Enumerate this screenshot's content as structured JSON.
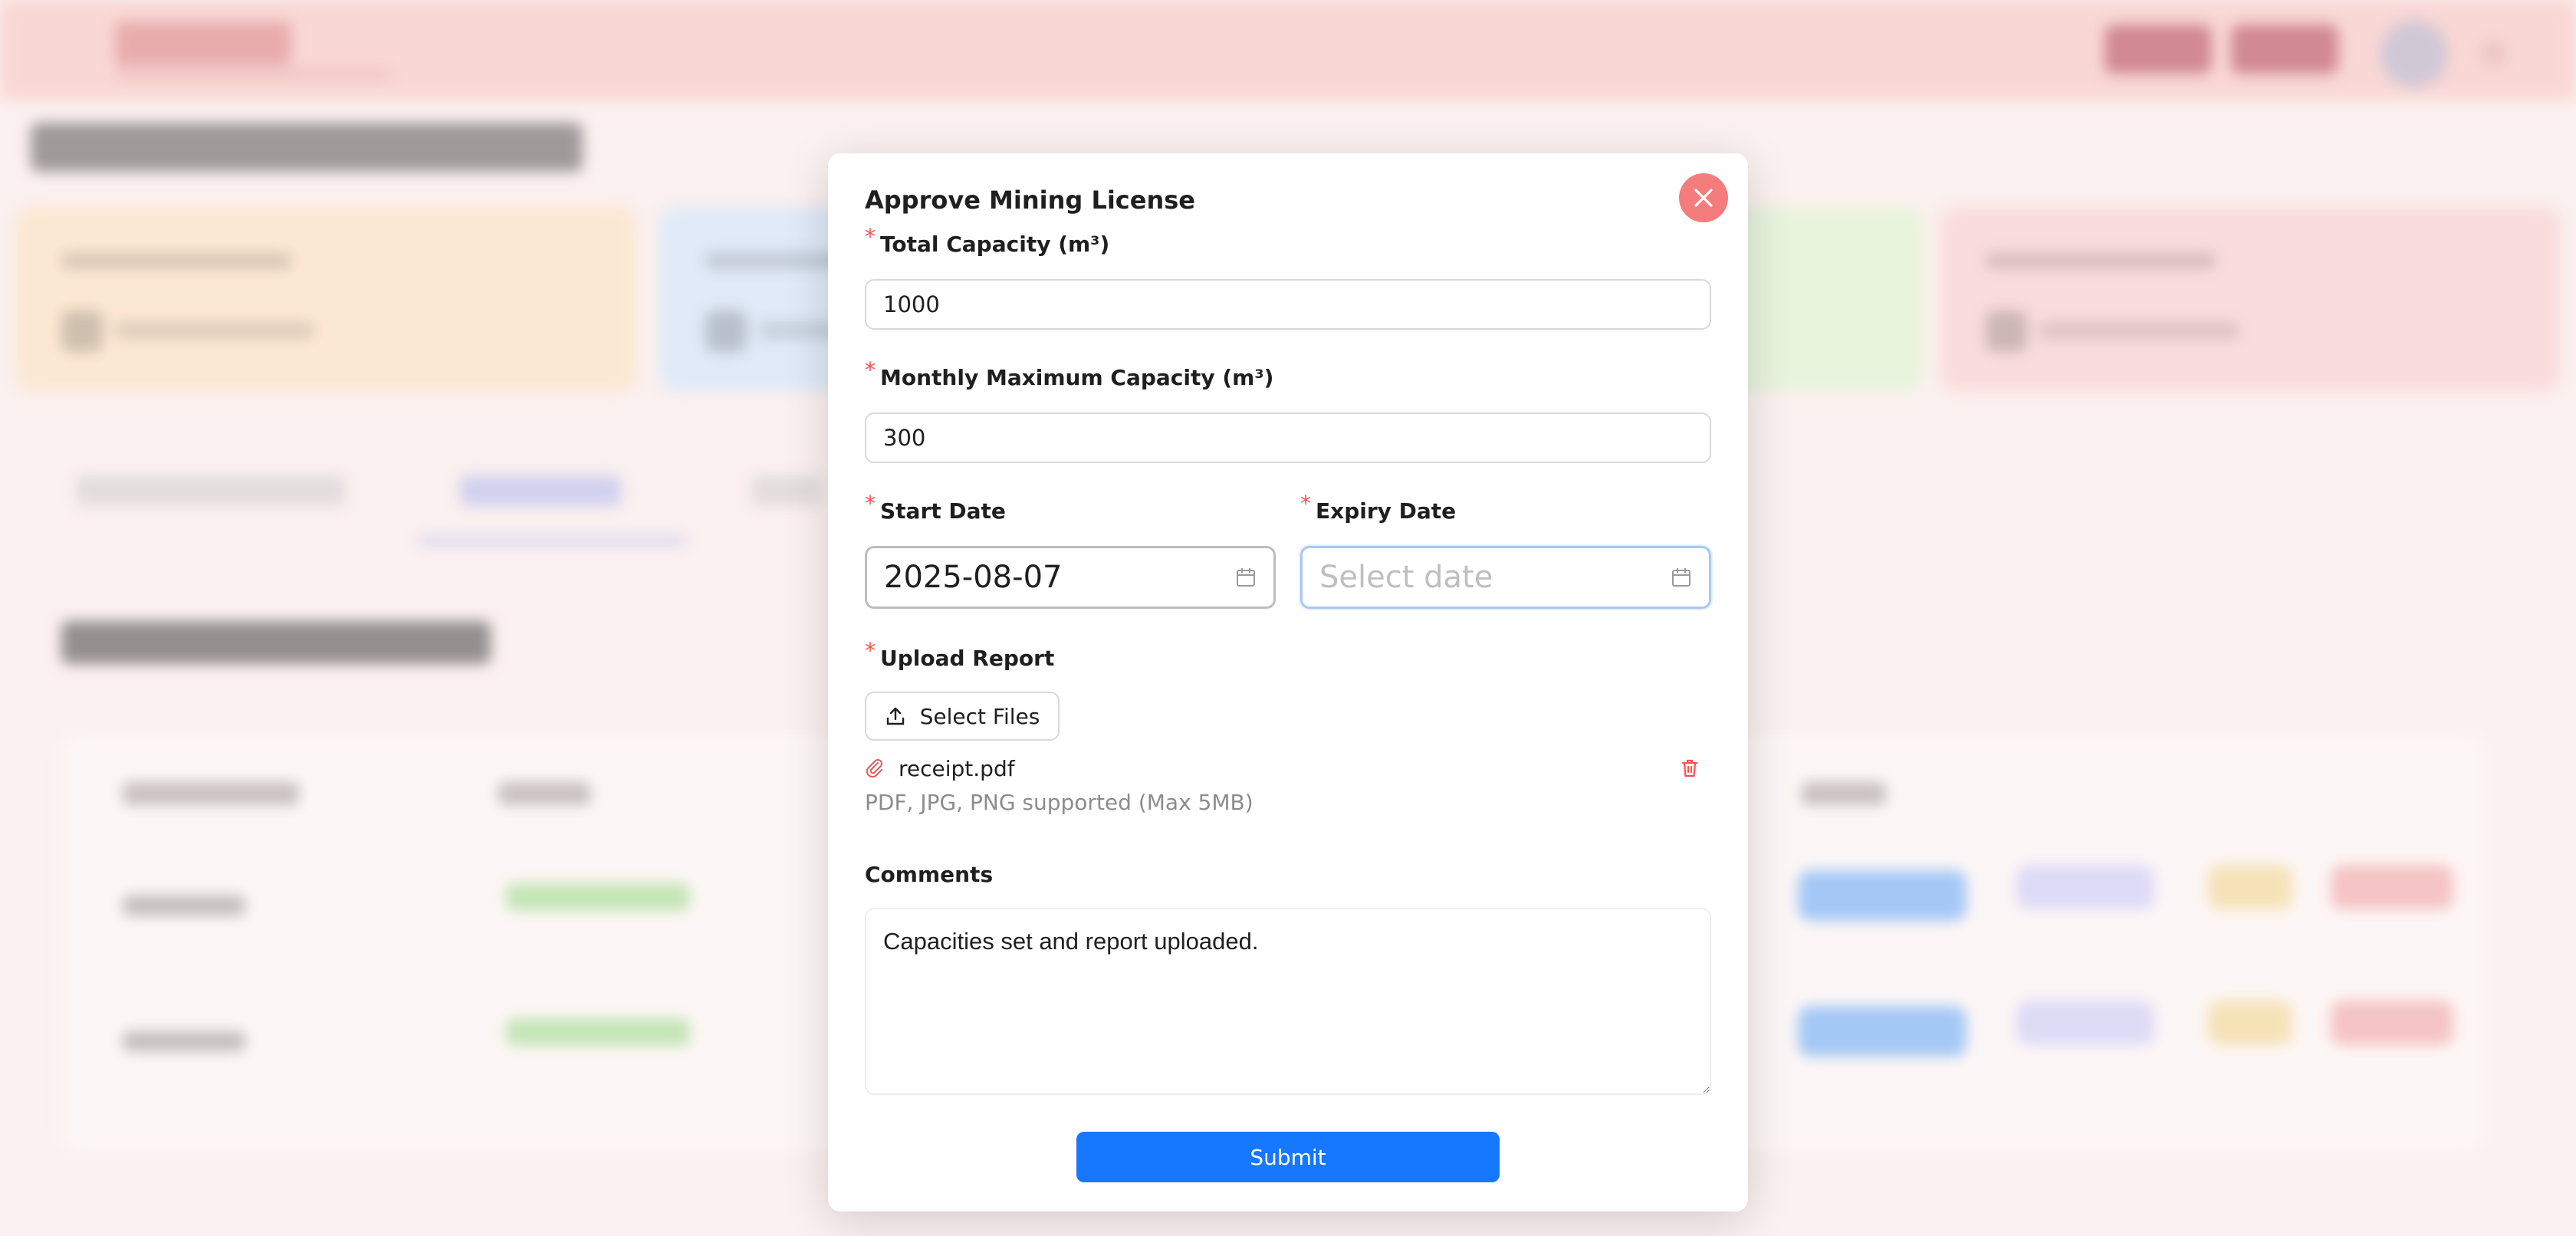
{
  "modal": {
    "title": "Approve Mining License",
    "fields": {
      "total_capacity": {
        "label": "Total Capacity (m³)",
        "value": "1000"
      },
      "monthly_max_capacity": {
        "label": "Monthly Maximum Capacity (m³)",
        "value": "300"
      },
      "start_date": {
        "label": "Start Date",
        "value": "2025-08-07"
      },
      "expiry_date": {
        "label": "Expiry Date",
        "placeholder": "Select date"
      },
      "upload_report": {
        "label": "Upload Report",
        "button_label": "Select Files",
        "file_name": "receipt.pdf",
        "hint": "PDF, JPG, PNG supported (Max 5MB)"
      },
      "comments": {
        "label": "Comments",
        "value": "Capacities set and report uploaded."
      }
    },
    "submit_label": "Submit",
    "required_mark": "*"
  },
  "icons": {
    "close": "close-icon",
    "calendar": "calendar-icon",
    "upload": "upload-icon",
    "attachment": "paperclip-icon",
    "delete": "trash-icon"
  },
  "colors": {
    "primary": "#1677ff",
    "danger": "#ff4d4f",
    "close_button": "#f47c7c",
    "header_background": "#f8cfcc"
  }
}
